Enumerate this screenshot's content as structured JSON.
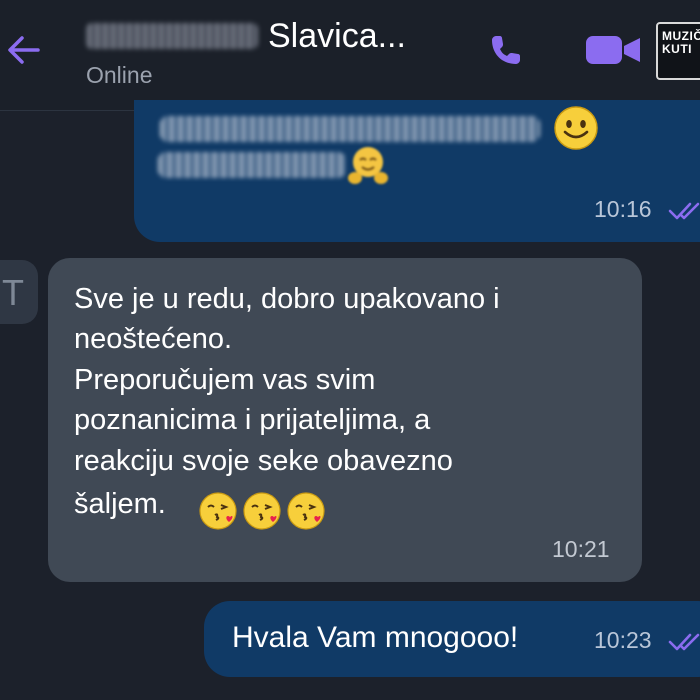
{
  "header": {
    "contact_name": "Slavica...",
    "status": "Online",
    "logo_text": "MUZIČ KUTI"
  },
  "messages": [
    {
      "direction": "outgoing",
      "text_redacted": true,
      "emojis": [
        "slightly-smiling-face",
        "hugging-face"
      ],
      "time": "10:16",
      "read": true
    },
    {
      "direction": "incoming",
      "avatar_initial": "T",
      "lines": [
        "Sve je u redu, dobro upakovano i",
        "neoštećeno.",
        "Preporučujem  vas svim",
        "poznanicima i prijateljima, a",
        "reakciju svoje seke obavezno",
        "šaljem."
      ],
      "emojis": [
        "face-blowing-kiss",
        "face-blowing-kiss",
        "face-blowing-kiss"
      ],
      "time": "10:21"
    },
    {
      "direction": "outgoing",
      "text": "Hvala Vam mnogooo!",
      "time": "10:23",
      "read": true
    }
  ],
  "colors": {
    "background": "#1c212b",
    "outgoing_bubble": "#103a66",
    "incoming_bubble": "#404955",
    "accent": "#8b6cf0"
  },
  "icons": [
    "back-arrow",
    "phone",
    "video-camera",
    "double-check"
  ]
}
